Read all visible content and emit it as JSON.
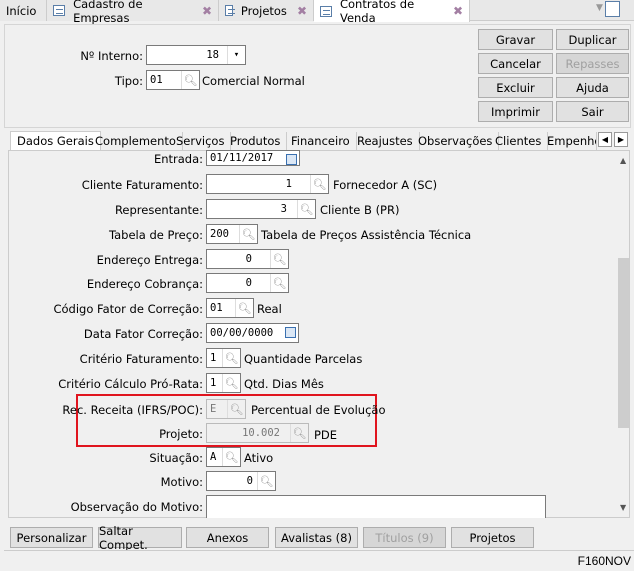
{
  "tabs": [
    {
      "label": "Início"
    },
    {
      "label": "Cadastro de Empresas"
    },
    {
      "label": "Projetos"
    },
    {
      "label": "Contratos de Venda"
    }
  ],
  "header": {
    "numero_label": "Nº Interno:",
    "numero_value": "18",
    "tipo_label": "Tipo:",
    "tipo_value": "01",
    "tipo_desc": "Comercial Normal"
  },
  "actions": {
    "gravar": "Gravar",
    "duplicar": "Duplicar",
    "cancelar": "Cancelar",
    "repasses": "Repasses",
    "excluir": "Excluir",
    "ajuda": "Ajuda",
    "imprimir": "Imprimir",
    "sair": "Sair"
  },
  "subtabs": [
    "Dados Gerais",
    "Complemento",
    "Serviços",
    "Produtos",
    "Financeiro",
    "Reajustes",
    "Observações",
    "Clientes",
    "Empenhos"
  ],
  "form": {
    "entrada": {
      "label": "Entrada:",
      "value": "01/11/2017"
    },
    "cliente": {
      "label": "Cliente Faturamento:",
      "value": "1",
      "desc": "Fornecedor A (SC)"
    },
    "representante": {
      "label": "Representante:",
      "value": "3",
      "desc": "Cliente B (PR)"
    },
    "tabela": {
      "label": "Tabela de Preço:",
      "value": "200",
      "desc": "Tabela de Preços Assistência Técnica"
    },
    "end_entrega": {
      "label": "Endereço Entrega:",
      "value": "0"
    },
    "end_cobranca": {
      "label": "Endereço Cobrança:",
      "value": "0"
    },
    "cod_fator": {
      "label": "Código Fator de Correção:",
      "value": "01",
      "desc": "Real"
    },
    "data_fator": {
      "label": "Data Fator Correção:",
      "value": "00/00/0000"
    },
    "crit_fat": {
      "label": "Critério Faturamento:",
      "value": "1",
      "desc": "Quantidade Parcelas"
    },
    "crit_pro": {
      "label": "Critério Cálculo Pró-Rata:",
      "value": "1",
      "desc": "Qtd. Dias Mês"
    },
    "rec_receita": {
      "label": "Rec. Receita (IFRS/POC):",
      "value": "E",
      "desc": "Percentual de Evolução"
    },
    "projeto": {
      "label": "Projeto:",
      "value": "10.002",
      "desc": "PDE"
    },
    "situacao": {
      "label": "Situação:",
      "value": "A",
      "desc": "Ativo"
    },
    "motivo": {
      "label": "Motivo:",
      "value": "0"
    },
    "obs_motivo": {
      "label": "Observação do Motivo:",
      "value": ""
    }
  },
  "bottom": {
    "personalizar": "Personalizar",
    "saltar": "Saltar Compet.",
    "anexos": "Anexos",
    "avalistas": "Avalistas (8)",
    "titulos": "Títulos (9)",
    "projetos": "Projetos"
  },
  "status": {
    "code": "F160NOV"
  },
  "highlight_color": "#e0141e"
}
